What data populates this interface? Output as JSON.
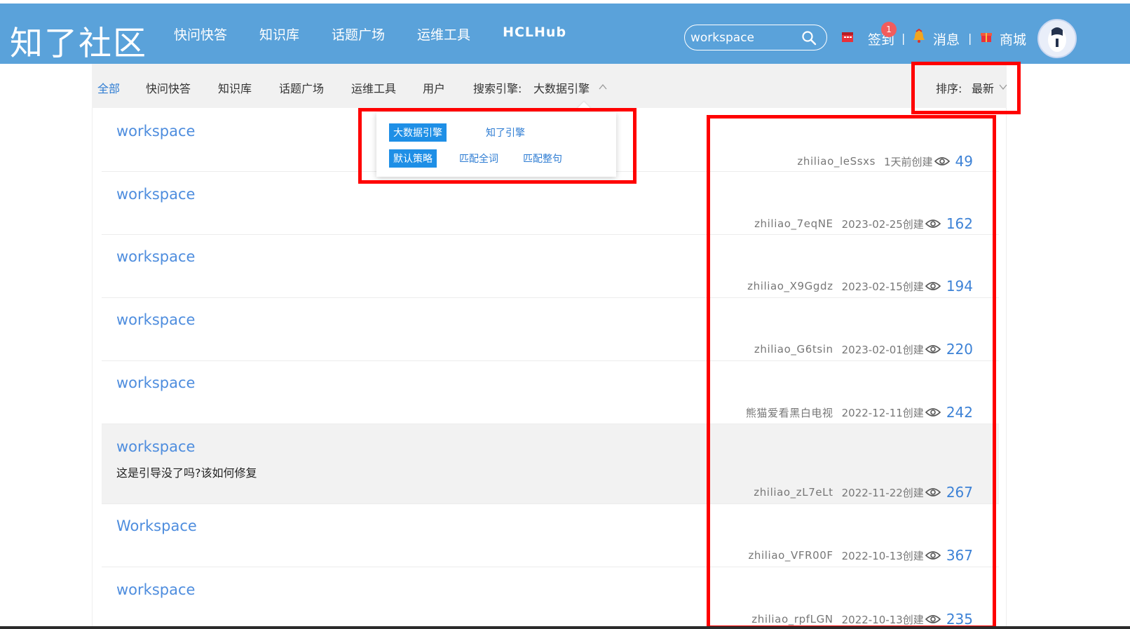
{
  "header": {
    "logo": "知了社区",
    "nav": [
      "快问快答",
      "知识库",
      "话题广场",
      "运维工具",
      "HCLHub"
    ],
    "search_value": "workspace",
    "checkin_label": "签到",
    "checkin_badge": "1",
    "messages_label": "消息",
    "mall_label": "商城",
    "separator": "|"
  },
  "filters": {
    "tabs": [
      "全部",
      "快问快答",
      "知识库",
      "话题广场",
      "运维工具",
      "用户"
    ],
    "active_tab": "全部",
    "engine_label": "搜索引擎:",
    "engine_value": "大数据引擎",
    "sort_label": "排序:",
    "sort_value": "最新"
  },
  "dropdown": {
    "engines": [
      "大数据引擎",
      "知了引擎"
    ],
    "strategies": [
      "默认策略",
      "匹配全词",
      "匹配整句"
    ],
    "selected_engine": "大数据引擎",
    "selected_strategy": "默认策略"
  },
  "results": [
    {
      "title": "workspace",
      "desc": "",
      "author": "zhiliao_leSsxs",
      "date": "1天前创建",
      "views": "49"
    },
    {
      "title": "workspace",
      "desc": "",
      "author": "zhiliao_7eqNE",
      "date": "2023-02-25创建",
      "views": "162"
    },
    {
      "title": "workspace",
      "desc": "",
      "author": "zhiliao_X9Ggdz",
      "date": "2023-02-15创建",
      "views": "194"
    },
    {
      "title": "workspace",
      "desc": "",
      "author": "zhiliao_G6tsin",
      "date": "2023-02-01创建",
      "views": "220"
    },
    {
      "title": "workspace",
      "desc": "",
      "author": "熊猫爱看黑白电视",
      "date": "2022-12-11创建",
      "views": "242"
    },
    {
      "title": "workspace",
      "desc": "这是引导没了吗?该如何修复",
      "author": "zhiliao_zL7eLt",
      "date": "2022-11-22创建",
      "views": "267"
    },
    {
      "title": "Workspace",
      "desc": "",
      "author": "zhiliao_VFR00F",
      "date": "2022-10-13创建",
      "views": "367"
    },
    {
      "title": "workspace",
      "desc": "",
      "author": "zhiliao_rpfLGN",
      "date": "2022-10-13创建",
      "views": "235"
    }
  ],
  "colors": {
    "header_bg": "#5aa2da",
    "link_blue": "#4e8dde",
    "annotation_red": "#ff0000",
    "selected_bg": "#1e8fe6"
  }
}
